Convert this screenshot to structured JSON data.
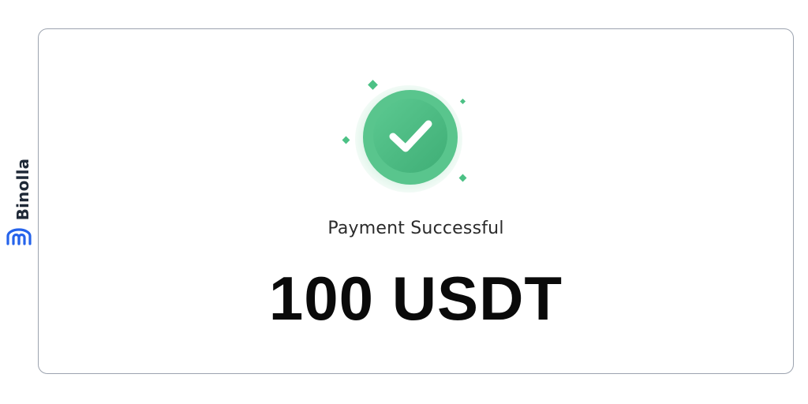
{
  "watermark": {
    "brand": "Binolla",
    "logo_icon": "binolla-logo-icon",
    "brand_color": "#2563eb"
  },
  "payment": {
    "icon": "check-circle-icon",
    "status_text": "Payment Successful",
    "amount_text": "100 USDT",
    "accent_color": "#4cc185"
  }
}
